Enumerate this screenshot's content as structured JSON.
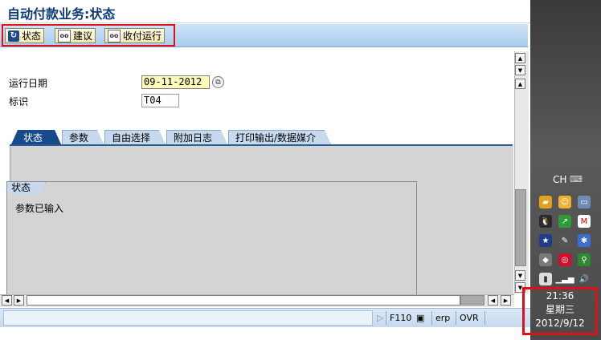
{
  "window": {
    "title": "自动付款业务:状态"
  },
  "app_toolbar": {
    "buttons": [
      {
        "label": "状态",
        "icon": "status-icon"
      },
      {
        "label": "建议",
        "icon": "proposal-icon"
      },
      {
        "label": "收付运行",
        "icon": "payment-run-icon"
      }
    ]
  },
  "form": {
    "run_date_label": "运行日期",
    "run_date_value": "09-11-2012",
    "id_label": "标识",
    "id_value": "T04"
  },
  "tabs": [
    {
      "label": "状态",
      "active": true
    },
    {
      "label": "参数",
      "active": false
    },
    {
      "label": "自由选择",
      "active": false
    },
    {
      "label": "附加日志",
      "active": false
    },
    {
      "label": "打印输出/数据媒介",
      "active": false
    }
  ],
  "status_group": {
    "title": "状态",
    "text": "参数已输入"
  },
  "status_bar": {
    "transaction": "F110",
    "system": "erp",
    "mode": "OVR"
  },
  "taskbar": {
    "language": "CH",
    "clock_time": "21:36",
    "clock_weekday": "星期三",
    "clock_date": "2012/9/12"
  },
  "colors": {
    "title": "#0e3b77",
    "active_tab": "#174a8a",
    "required_field": "#fffbb8",
    "highlight_box": "#e0101a"
  }
}
